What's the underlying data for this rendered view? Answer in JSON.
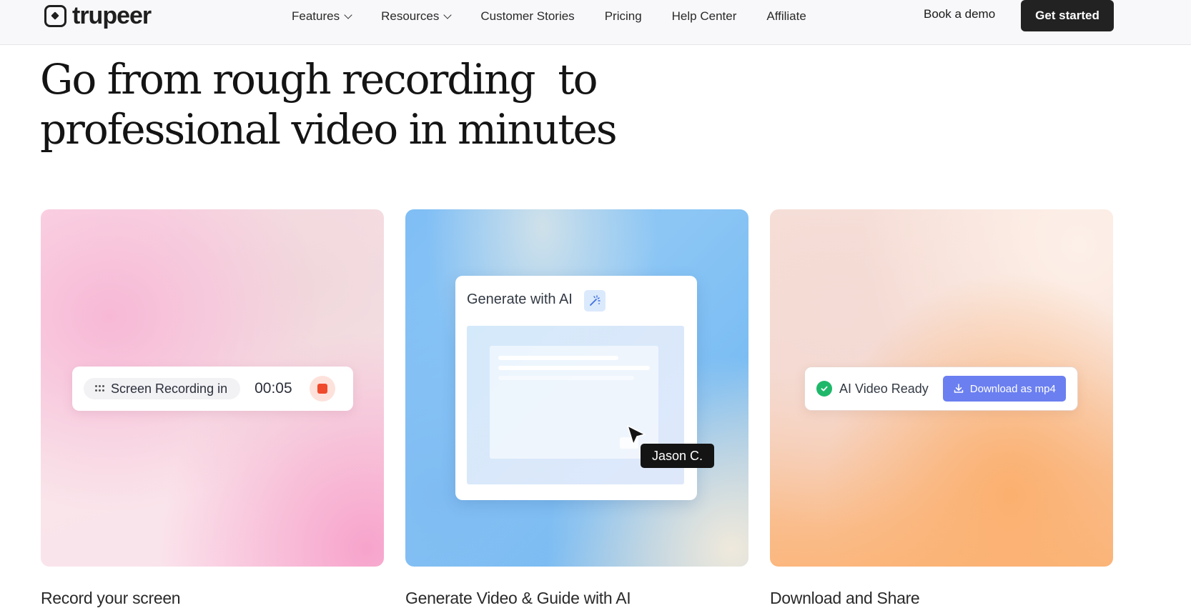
{
  "nav": {
    "logo_text": "trupeer",
    "links": [
      {
        "label": "Features",
        "has_dropdown": true
      },
      {
        "label": "Resources",
        "has_dropdown": true
      },
      {
        "label": "Customer Stories",
        "has_dropdown": false
      },
      {
        "label": "Pricing",
        "has_dropdown": false
      },
      {
        "label": "Help Center",
        "has_dropdown": false
      },
      {
        "label": "Affiliate",
        "has_dropdown": false
      }
    ],
    "book_demo": "Book a demo",
    "get_started": "Get started"
  },
  "hero": {
    "line1": "Go from rough recording  to",
    "line2": "professional video in minutes"
  },
  "cards": [
    {
      "caption": "Record your screen",
      "recorder_label": "Screen Recording in",
      "recorder_time": "00:05"
    },
    {
      "caption": "Generate Video & Guide with AI",
      "panel_title": "Generate with AI",
      "cursor_tag": "Jason C."
    },
    {
      "caption": "Download and Share",
      "status_label": "AI Video Ready",
      "download_label": "Download as mp4"
    }
  ],
  "colors": {
    "primary_dark": "#222222",
    "record_red": "#f04a2c",
    "ready_green": "#1fb86a",
    "download_blue": "#6b7ff0"
  }
}
